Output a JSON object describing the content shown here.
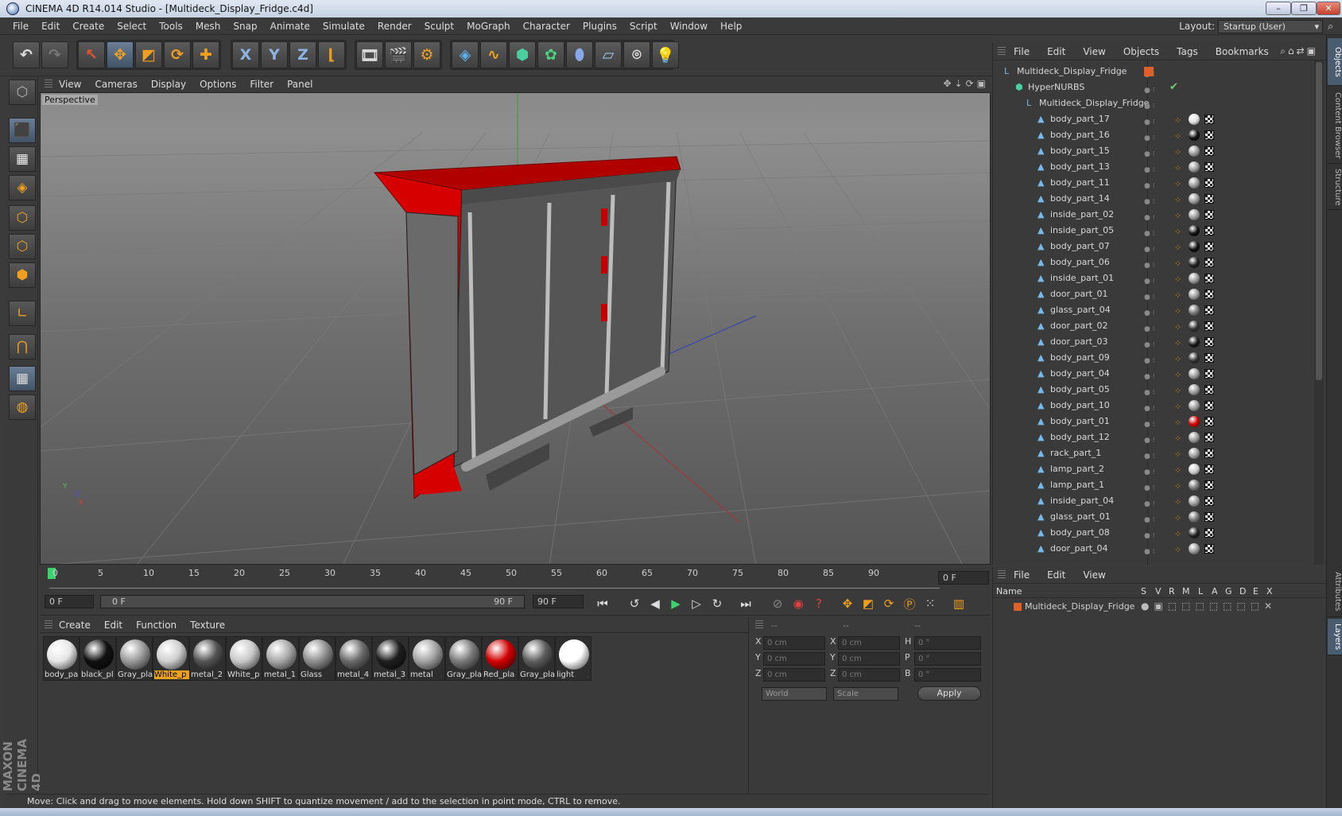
{
  "window": {
    "title": "CINEMA 4D R14.014 Studio - [Multideck_Display_Fridge.c4d]",
    "minimize": "–",
    "restore": "❐",
    "close": "✕"
  },
  "menubar": [
    "File",
    "Edit",
    "Create",
    "Select",
    "Tools",
    "Mesh",
    "Snap",
    "Animate",
    "Simulate",
    "Render",
    "Sculpt",
    "MoGraph",
    "Character",
    "Plugins",
    "Script",
    "Window",
    "Help"
  ],
  "layout": {
    "label": "Layout:",
    "value": "Startup (User)"
  },
  "toolbar": {
    "axis_x": "X",
    "axis_y": "Y",
    "axis_z": "Z"
  },
  "viewport": {
    "menu": [
      "View",
      "Cameras",
      "Display",
      "Options",
      "Filter",
      "Panel"
    ],
    "label": "Perspective",
    "axis_y": "Y",
    "axis_x": "X",
    "axis_z": "Z"
  },
  "timeline": {
    "ticks": [
      "0",
      "5",
      "10",
      "15",
      "20",
      "25",
      "30",
      "35",
      "40",
      "45",
      "50",
      "55",
      "60",
      "65",
      "70",
      "75",
      "80",
      "85",
      "90"
    ],
    "current_frame": "0 F",
    "start_field": "0 F",
    "slider_start": "0 F",
    "slider_end": "90 F",
    "end_field": "90 F"
  },
  "materials": {
    "menu": [
      "Create",
      "Edit",
      "Function",
      "Texture"
    ],
    "items": [
      {
        "name": "body_pa",
        "color": "#e6e6e6"
      },
      {
        "name": "black_pl",
        "color": "#111111"
      },
      {
        "name": "Gray_pla",
        "color": "#9a9a9a"
      },
      {
        "name": "White_p",
        "color": "#cfcfcf"
      },
      {
        "name": "metal_2",
        "color": "#555555"
      },
      {
        "name": "White_p",
        "color": "#c8c8c8"
      },
      {
        "name": "metal_1",
        "color": "#a8a8a8"
      },
      {
        "name": "Glass",
        "color": "#8e8e8e"
      },
      {
        "name": "metal_4",
        "color": "#6a6a6a"
      },
      {
        "name": "metal_3",
        "color": "#1e1e1e"
      },
      {
        "name": "metal",
        "color": "#a3a3a3"
      },
      {
        "name": "Gray_pla",
        "color": "#7a7a7a"
      },
      {
        "name": "Red_pla",
        "color": "#d10000"
      },
      {
        "name": "Gray_pla",
        "color": "#5e5e5e"
      },
      {
        "name": "light",
        "color": "#ffffff"
      }
    ]
  },
  "coords": {
    "header": [
      "--",
      "--",
      "--"
    ],
    "rows": [
      {
        "a": "X",
        "av": "0 cm",
        "b": "X",
        "bv": "0 cm",
        "c": "H",
        "cv": "0 °"
      },
      {
        "a": "Y",
        "av": "0 cm",
        "b": "Y",
        "bv": "0 cm",
        "c": "P",
        "cv": "0 °"
      },
      {
        "a": "Z",
        "av": "0 cm",
        "b": "Z",
        "bv": "0 cm",
        "c": "B",
        "cv": "0 °"
      }
    ],
    "world": "World",
    "scale": "Scale",
    "apply": "Apply"
  },
  "objects": {
    "menu": [
      "File",
      "Edit",
      "View",
      "Objects",
      "Tags",
      "Bookmarks"
    ],
    "root": "Multideck_Display_Fridge",
    "hypernurbs": "HyperNURBS",
    "child": "Multideck_Display_Fridge",
    "items": [
      {
        "name": "body_part_17",
        "mat": "#e0e0e0"
      },
      {
        "name": "body_part_16",
        "mat": "#111111"
      },
      {
        "name": "body_part_15",
        "mat": "#9a9a9a"
      },
      {
        "name": "body_part_13",
        "mat": "#9a9a9a"
      },
      {
        "name": "body_part_11",
        "mat": "#9a9a9a"
      },
      {
        "name": "body_part_14",
        "mat": "#9a9a9a"
      },
      {
        "name": "inside_part_02",
        "mat": "#9a9a9a"
      },
      {
        "name": "inside_part_05",
        "mat": "#111111"
      },
      {
        "name": "body_part_07",
        "mat": "#111111"
      },
      {
        "name": "body_part_06",
        "mat": "#222222"
      },
      {
        "name": "inside_part_01",
        "mat": "#9a9a9a"
      },
      {
        "name": "door_part_01",
        "mat": "#9a9a9a"
      },
      {
        "name": "glass_part_04",
        "mat": "#777777"
      },
      {
        "name": "door_part_02",
        "mat": "#333333"
      },
      {
        "name": "door_part_03",
        "mat": "#1a1a1a"
      },
      {
        "name": "body_part_09",
        "mat": "#333333"
      },
      {
        "name": "body_part_04",
        "mat": "#9a9a9a"
      },
      {
        "name": "body_part_05",
        "mat": "#9a9a9a"
      },
      {
        "name": "body_part_10",
        "mat": "#9a9a9a"
      },
      {
        "name": "body_part_01",
        "mat": "#d10000"
      },
      {
        "name": "body_part_12",
        "mat": "#9a9a9a"
      },
      {
        "name": "rack_part_1",
        "mat": "#9a9a9a"
      },
      {
        "name": "lamp_part_2",
        "mat": "#cfcfcf"
      },
      {
        "name": "lamp_part_1",
        "mat": "#777777"
      },
      {
        "name": "inside_part_04",
        "mat": "#9a9a9a"
      },
      {
        "name": "glass_part_01",
        "mat": "#777777"
      },
      {
        "name": "body_part_08",
        "mat": "#222222"
      },
      {
        "name": "door_part_04",
        "mat": "#9a9a9a"
      }
    ]
  },
  "layers": {
    "menu": [
      "File",
      "Edit",
      "View"
    ],
    "columns": [
      "Name",
      "S",
      "V",
      "R",
      "M",
      "L",
      "A",
      "G",
      "D",
      "E",
      "X"
    ],
    "row": "Multideck_Display_Fridge"
  },
  "righttabs": [
    "Objects",
    "Content Browser",
    "Structure",
    "Attributes",
    "Layers"
  ],
  "status": "Move: Click and drag to move elements. Hold down SHIFT to quantize movement / add to the selection in point mode, CTRL to remove.",
  "logo": "MAXON CINEMA 4D",
  "colors": {
    "accent": "#e8a21e",
    "selection": "#6b7e94",
    "fridge_red": "#e00000"
  }
}
